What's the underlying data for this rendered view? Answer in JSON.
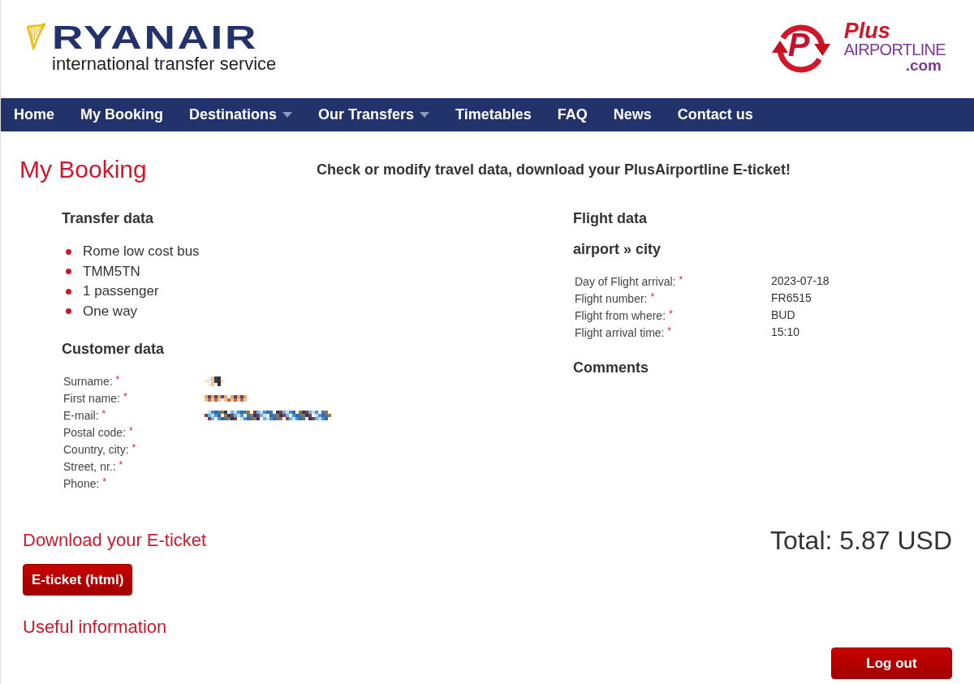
{
  "header": {
    "logo": {
      "name": "RYANAIR",
      "tagline": "international transfer service"
    },
    "partner_logo": {
      "mark": "P",
      "word_1": "Plus",
      "word_2": "AIRPORTLINE",
      "word_3": ".com"
    }
  },
  "nav": [
    {
      "label": "Home",
      "has_menu": false
    },
    {
      "label": "My Booking",
      "has_menu": false
    },
    {
      "label": "Destinations",
      "has_menu": true
    },
    {
      "label": "Our Transfers",
      "has_menu": true
    },
    {
      "label": "Timetables",
      "has_menu": false
    },
    {
      "label": "FAQ",
      "has_menu": false
    },
    {
      "label": "News",
      "has_menu": false
    },
    {
      "label": "Contact us",
      "has_menu": false
    }
  ],
  "page": {
    "title": "My Booking",
    "subtitle": "Check or modify travel data, download your PlusAirportline E-ticket!"
  },
  "transfer_data": {
    "title": "Transfer data",
    "items": [
      "Rome low cost bus",
      "TMM5TN",
      "1 passenger",
      "One way"
    ]
  },
  "customer_data": {
    "title": "Customer data",
    "rows": [
      {
        "label": "Surname:",
        "required_mark": "*",
        "redacted": true
      },
      {
        "label": "First name:",
        "required_mark": "*",
        "redacted": true
      },
      {
        "label": "E-mail:",
        "required_mark": "*",
        "redacted": true
      },
      {
        "label": "Postal code:",
        "required_mark": "*",
        "redacted": false
      },
      {
        "label": "Country, city:",
        "required_mark": "*",
        "redacted": false
      },
      {
        "label": "Street, nr.:",
        "required_mark": "*",
        "redacted": false
      },
      {
        "label": "Phone:",
        "required_mark": "*",
        "redacted": false
      }
    ]
  },
  "flight_data": {
    "title": "Flight data",
    "direction": "airport » city",
    "rows": [
      {
        "label": "Day of Flight arrival:",
        "required_mark": "*",
        "value": "2023-07-18"
      },
      {
        "label": "Flight number:",
        "required_mark": "*",
        "value": "FR6515"
      },
      {
        "label": "Flight from where:",
        "required_mark": "*",
        "value": "BUD"
      },
      {
        "label": "Flight arrival time:",
        "required_mark": "*",
        "value": "15:10"
      }
    ]
  },
  "comments": {
    "title": "Comments"
  },
  "download": {
    "title": "Download your E-ticket",
    "button": "E-ticket (html)"
  },
  "total": "Total: 5.87 USD",
  "useful_information": {
    "title": "Useful information"
  },
  "logout_button": "Log out"
}
